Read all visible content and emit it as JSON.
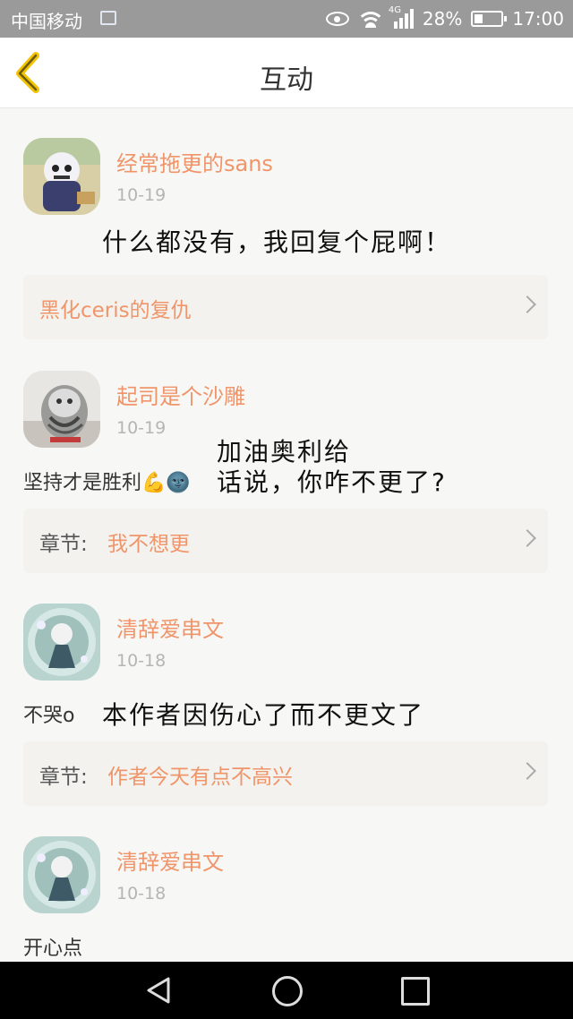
{
  "status_bar": {
    "carrier": "中国移动",
    "network": "4G",
    "battery": "28%",
    "time": "17:00"
  },
  "header": {
    "title": "互动"
  },
  "comments": [
    {
      "user": "经常拖更的sans",
      "date": "10-19",
      "text": "",
      "handwritten": [
        "什么都没有，我回复个屁啊！"
      ],
      "ref_label": "",
      "ref_title": "黑化ceris的复仇"
    },
    {
      "user": "起司是个沙雕",
      "date": "10-19",
      "text": "坚持才是胜利💪🌚",
      "handwritten": [
        "加油奥利给",
        "话说，你咋不更了?"
      ],
      "ref_label": "章节:",
      "ref_title": "我不想更"
    },
    {
      "user": "清辞爱串文",
      "date": "10-18",
      "text": "不哭o",
      "handwritten": [
        "本作者因伤心了而不更文了"
      ],
      "ref_label": "章节:",
      "ref_title": "作者今天有点不高兴"
    },
    {
      "user": "清辞爱串文",
      "date": "10-18",
      "text": "开心点"
    }
  ],
  "colors": {
    "accent": "#f0956a",
    "back_arrow": "#e8b800",
    "ref_background": "#f3f2ee",
    "page_background": "#f7f7f5"
  }
}
